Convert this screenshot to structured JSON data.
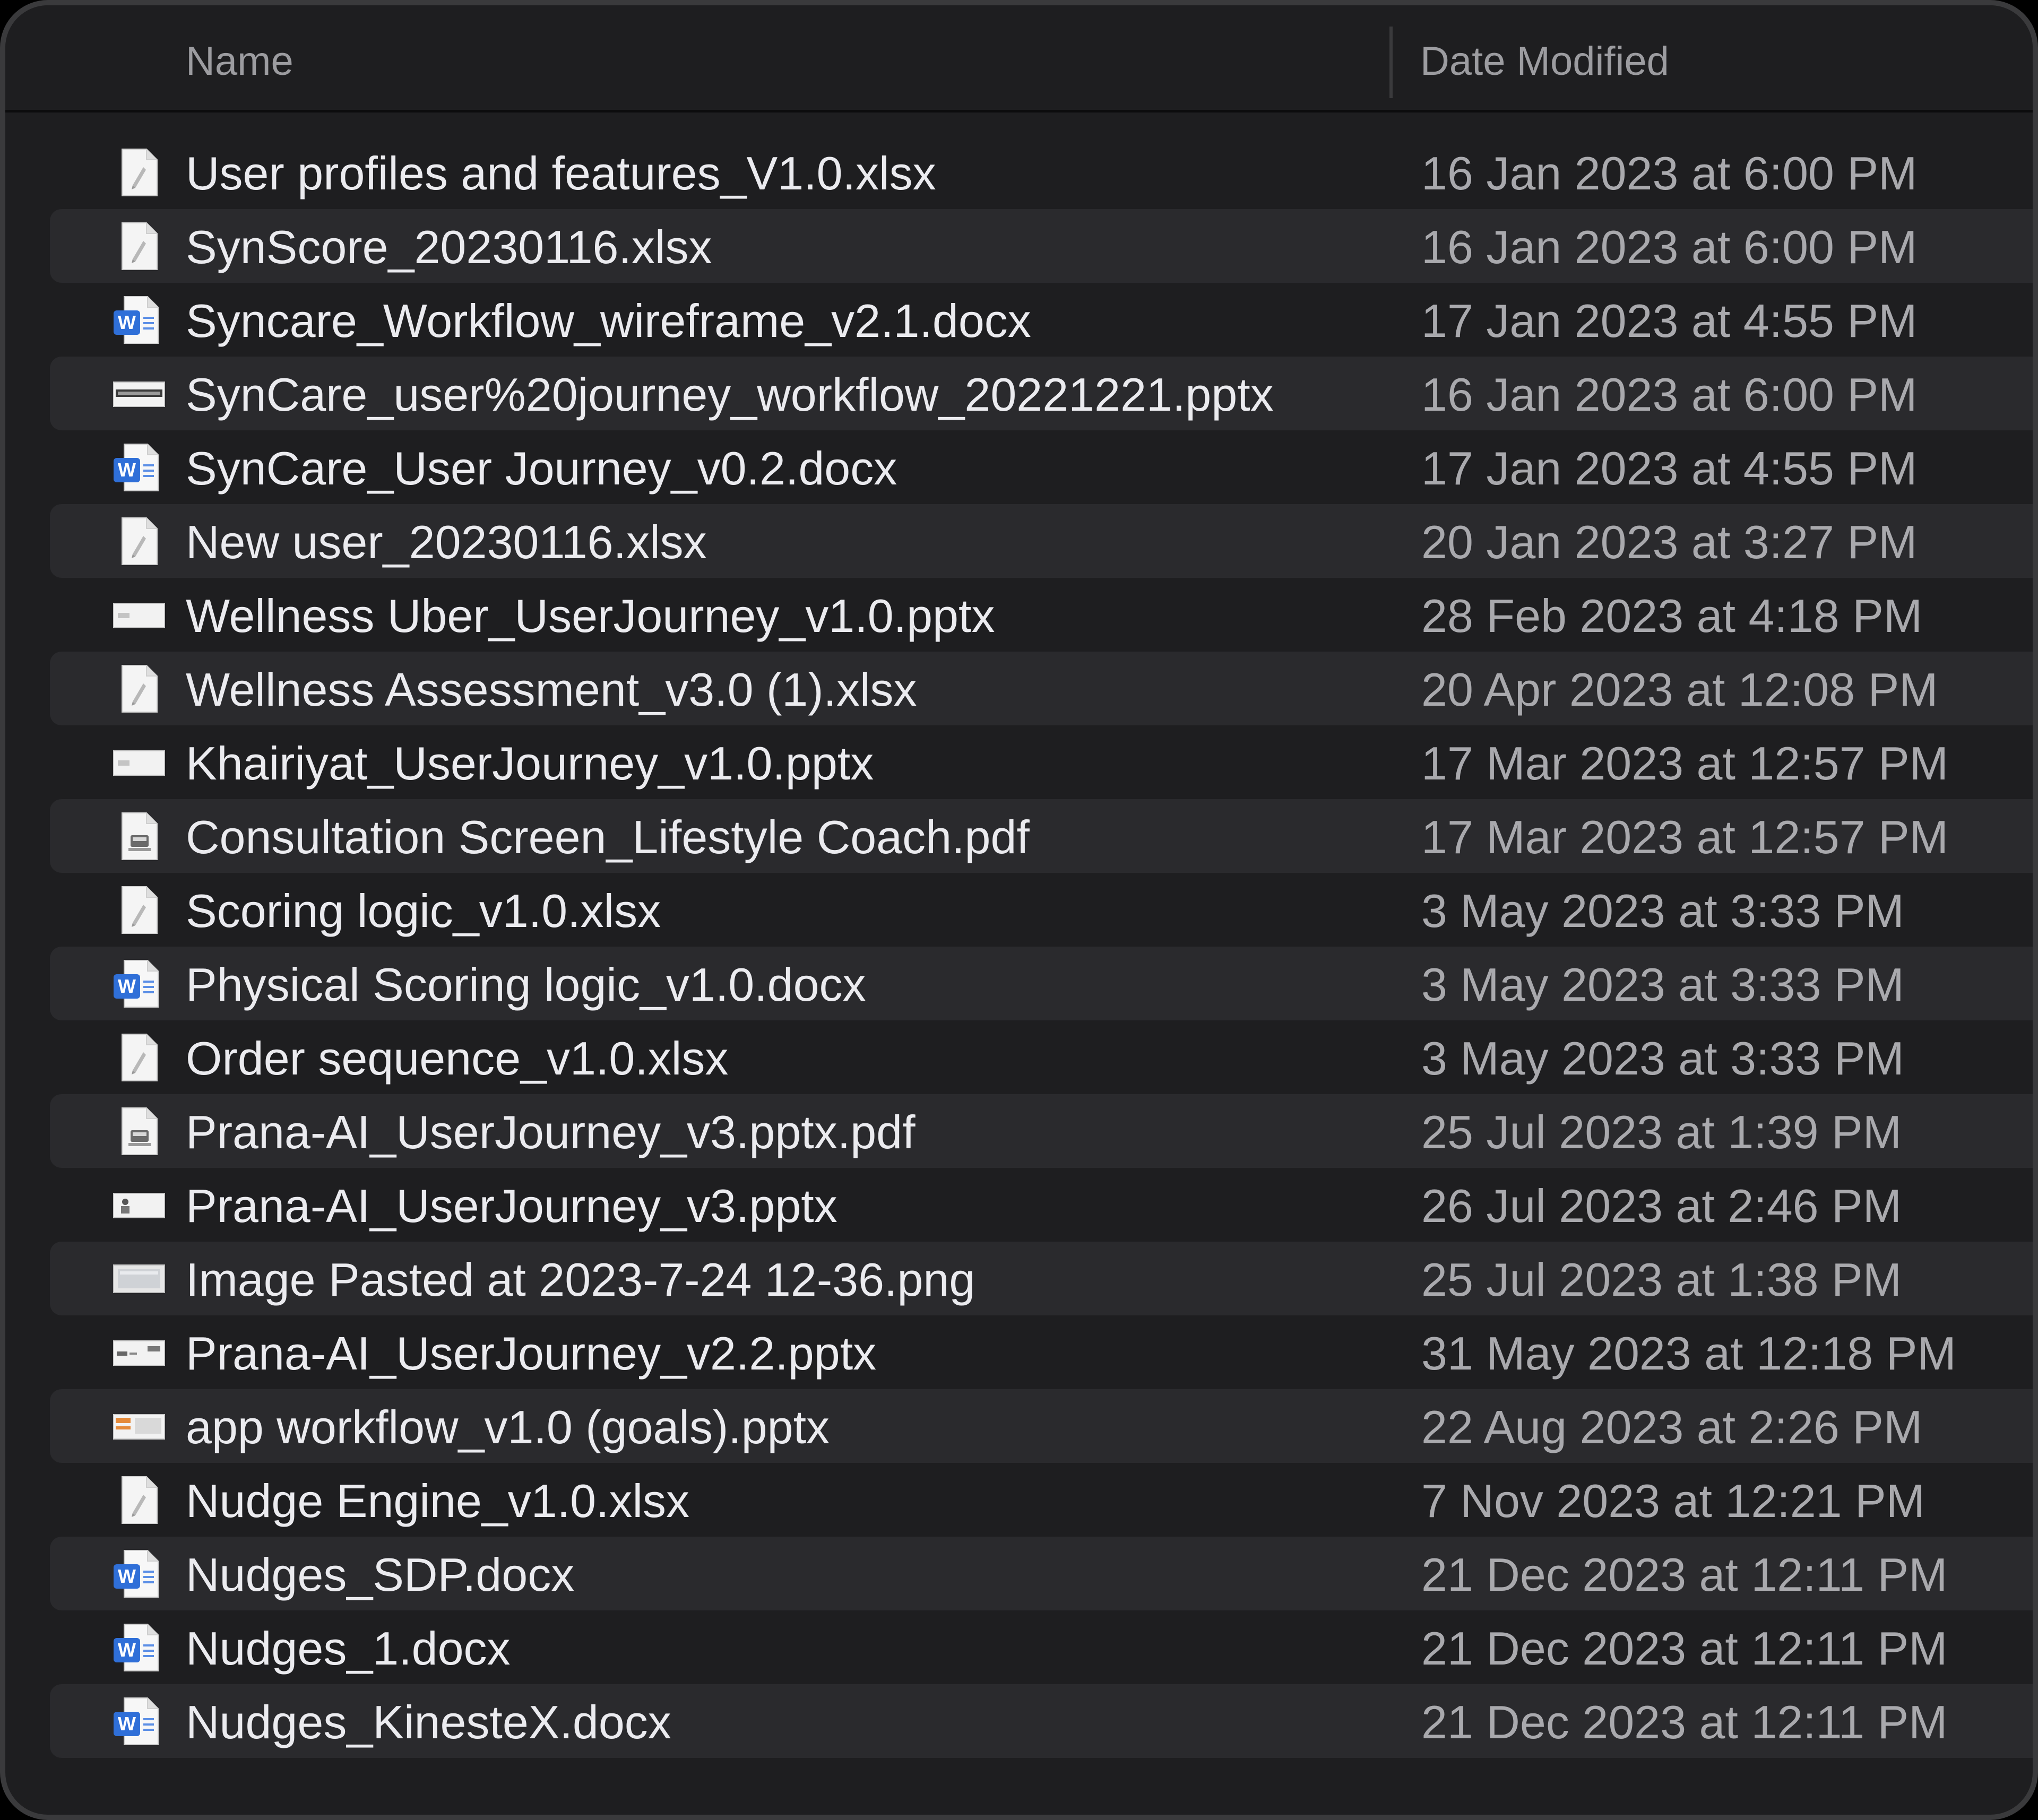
{
  "columns": {
    "name": "Name",
    "date_modified": "Date Modified"
  },
  "files": [
    {
      "name": "User profiles and features_V1.0.xlsx",
      "date": "16 Jan 2023 at 6:00 PM",
      "icon": "spreadsheet-icon"
    },
    {
      "name": "SynScore_20230116.xlsx",
      "date": "16 Jan 2023 at 6:00 PM",
      "icon": "spreadsheet-icon"
    },
    {
      "name": "Syncare_Workflow_wireframe_v2.1.docx",
      "date": "17 Jan 2023 at 4:55 PM",
      "icon": "word-document-icon"
    },
    {
      "name": "SynCare_user%20journey_workflow_20221221.pptx",
      "date": "16 Jan 2023 at 6:00 PM",
      "icon": "presentation-thumbnail-icon"
    },
    {
      "name": "SynCare_User Journey_v0.2.docx",
      "date": "17 Jan 2023 at 4:55 PM",
      "icon": "word-document-icon"
    },
    {
      "name": "New user_20230116.xlsx",
      "date": "20 Jan 2023 at 3:27 PM",
      "icon": "spreadsheet-icon"
    },
    {
      "name": "Wellness Uber_UserJourney_v1.0.pptx",
      "date": "28 Feb 2023 at 4:18 PM",
      "icon": "presentation-thumbnail-icon"
    },
    {
      "name": "Wellness Assessment_v3.0 (1).xlsx",
      "date": "20 Apr 2023 at 12:08 PM",
      "icon": "spreadsheet-icon"
    },
    {
      "name": "Khairiyat_UserJourney_v1.0.pptx",
      "date": "17 Mar 2023 at 12:57 PM",
      "icon": "presentation-thumbnail-icon"
    },
    {
      "name": "Consultation Screen_Lifestyle Coach.pdf",
      "date": "17 Mar 2023 at 12:57 PM",
      "icon": "pdf-document-icon"
    },
    {
      "name": "Scoring logic_v1.0.xlsx",
      "date": "3 May 2023 at 3:33 PM",
      "icon": "spreadsheet-icon"
    },
    {
      "name": "Physical Scoring logic_v1.0.docx",
      "date": "3 May 2023 at 3:33 PM",
      "icon": "word-document-icon"
    },
    {
      "name": "Order sequence_v1.0.xlsx",
      "date": "3 May 2023 at 3:33 PM",
      "icon": "spreadsheet-icon"
    },
    {
      "name": "Prana-AI_UserJourney_v3.pptx.pdf",
      "date": "25 Jul 2023 at 1:39 PM",
      "icon": "pdf-document-icon"
    },
    {
      "name": "Prana-AI_UserJourney_v3.pptx",
      "date": "26 Jul 2023 at 2:46 PM",
      "icon": "presentation-thumbnail-icon"
    },
    {
      "name": "Image Pasted at 2023-7-24 12-36.png",
      "date": "25 Jul 2023 at 1:38 PM",
      "icon": "image-thumbnail-icon"
    },
    {
      "name": "Prana-AI_UserJourney_v2.2.pptx",
      "date": "31 May 2023 at 12:18 PM",
      "icon": "presentation-thumbnail-icon"
    },
    {
      "name": "app workflow_v1.0 (goals).pptx",
      "date": "22 Aug 2023 at 2:26 PM",
      "icon": "presentation-thumbnail-icon"
    },
    {
      "name": "Nudge Engine_v1.0.xlsx",
      "date": "7 Nov 2023 at 12:21 PM",
      "icon": "spreadsheet-icon"
    },
    {
      "name": "Nudges_SDP.docx",
      "date": "21 Dec 2023 at 12:11 PM",
      "icon": "word-document-icon"
    },
    {
      "name": "Nudges_1.docx",
      "date": "21 Dec 2023 at 12:11 PM",
      "icon": "word-document-icon"
    },
    {
      "name": "Nudges_KinesteX.docx",
      "date": "21 Dec 2023 at 12:11 PM",
      "icon": "word-document-icon"
    }
  ],
  "colors": {
    "background": "#1e1e20",
    "alternate_row": "#2a2a2d",
    "name_text": "#ebebef",
    "date_text": "#a9a9ad",
    "header_text": "#9c9ca0",
    "word_blue": "#2f6fd8"
  }
}
